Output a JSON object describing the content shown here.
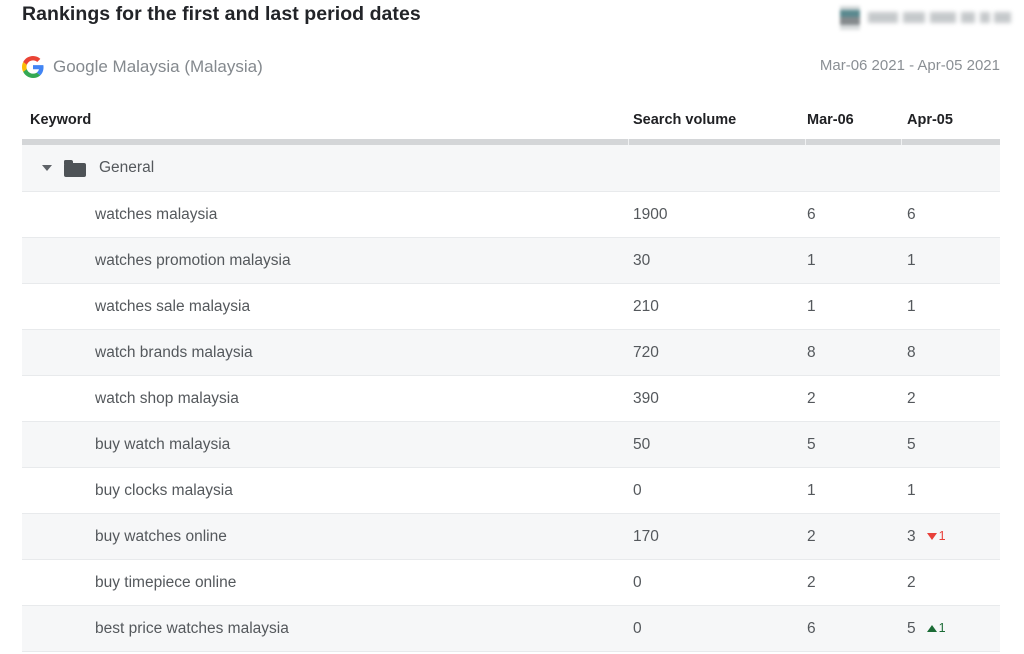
{
  "header": {
    "title": "Rankings for the first and last period dates",
    "brand_logo": "redacted-brand-logo",
    "source_icon": "google-g-icon",
    "source_name": "Google Malaysia (Malaysia)",
    "date_range": "Mar-06 2021 - Apr-05 2021"
  },
  "table": {
    "columns": {
      "keyword": "Keyword",
      "search_volume": "Search volume",
      "first_date": "Mar-06",
      "last_date": "Apr-05"
    },
    "group": {
      "label": "General",
      "expanded": true,
      "caret_icon": "chevron-down-icon",
      "folder_icon": "folder-icon"
    },
    "rows": [
      {
        "keyword": "watches malaysia",
        "volume": "1900",
        "first": "6",
        "last": "6",
        "delta": null
      },
      {
        "keyword": "watches promotion malaysia",
        "volume": "30",
        "first": "1",
        "last": "1",
        "delta": null
      },
      {
        "keyword": "watches sale malaysia",
        "volume": "210",
        "first": "1",
        "last": "1",
        "delta": null
      },
      {
        "keyword": "watch brands malaysia",
        "volume": "720",
        "first": "8",
        "last": "8",
        "delta": null
      },
      {
        "keyword": "watch shop malaysia",
        "volume": "390",
        "first": "2",
        "last": "2",
        "delta": null
      },
      {
        "keyword": "buy watch malaysia",
        "volume": "50",
        "first": "5",
        "last": "5",
        "delta": null
      },
      {
        "keyword": "buy clocks malaysia",
        "volume": "0",
        "first": "1",
        "last": "1",
        "delta": null
      },
      {
        "keyword": "buy watches online",
        "volume": "170",
        "first": "2",
        "last": "3",
        "delta": {
          "direction": "down",
          "value": "1",
          "icon": "triangle-down-icon"
        }
      },
      {
        "keyword": "buy timepiece online",
        "volume": "0",
        "first": "2",
        "last": "2",
        "delta": null
      },
      {
        "keyword": "best price watches malaysia",
        "volume": "0",
        "first": "6",
        "last": "5",
        "delta": {
          "direction": "up",
          "value": "1",
          "icon": "triangle-up-icon"
        }
      }
    ]
  },
  "colors": {
    "delta_down": "#e8403a",
    "delta_up": "#1b6b36",
    "row_alt": "#f6f7f8",
    "header_rule": "#d4d6d8"
  }
}
